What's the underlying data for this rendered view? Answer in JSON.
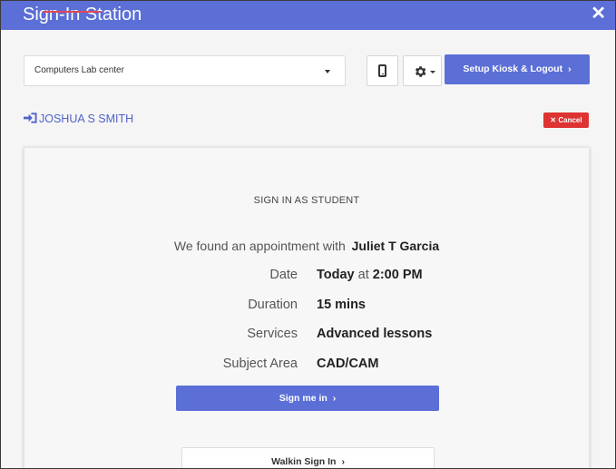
{
  "window": {
    "title": "Sign-In Station",
    "close_glyph": "✕"
  },
  "toolbar": {
    "location_select": "Computers Lab center",
    "setup_button": "Setup Kiosk & Logout",
    "chevron": "›"
  },
  "user": {
    "name": "JOSHUA S SMITH"
  },
  "cancel_button": "Cancel",
  "card": {
    "heading": "SIGN IN AS STUDENT",
    "appointment_prefix": "We found an appointment with",
    "tutor_name": "Juliet T Garcia",
    "rows": [
      {
        "label": "Date",
        "value_bold": "Today",
        "value_plain": " at ",
        "value_bold2": "2:00 PM"
      },
      {
        "label": "Duration",
        "value": "15 mins"
      },
      {
        "label": "Services",
        "value": "Advanced lessons"
      },
      {
        "label": "Subject Area",
        "value": "CAD/CAM"
      }
    ],
    "sign_me_in_button": "Sign me in",
    "walkin_button": "Walkin Sign In"
  },
  "colors": {
    "accent": "#5b6fd6",
    "danger": "#dd3333",
    "link": "#4f63c9"
  },
  "icons": [
    "close-icon",
    "dropdown-caret-icon",
    "mobile-phone-icon",
    "gear-icon",
    "sign-in-icon",
    "chevron-right-icon"
  ]
}
